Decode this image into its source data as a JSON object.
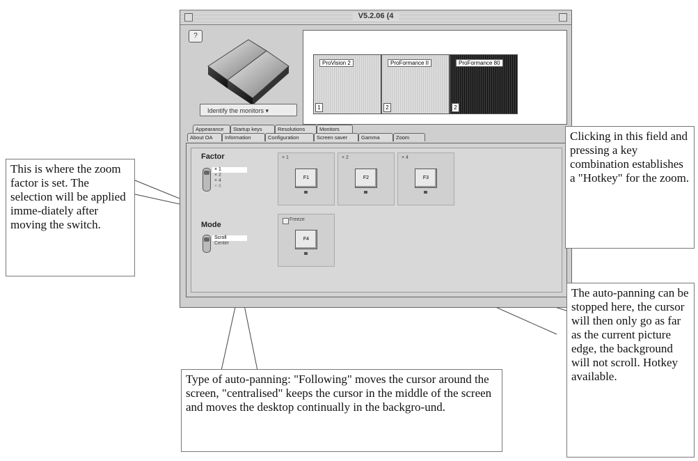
{
  "window": {
    "title": "V5.2.06 (4",
    "identify_button": "Identify the monitors",
    "monitors": [
      {
        "label": "ProVision 2",
        "number": "1"
      },
      {
        "label": "ProFormance II",
        "number": "2"
      },
      {
        "label": "ProFormance 80",
        "number": "2"
      }
    ],
    "tabs_row1": [
      "Appearance",
      "Startup keys",
      "Resolutions",
      "Monitors"
    ],
    "tabs_row2": [
      "About OA",
      "Information",
      "Configuration",
      "Screen saver",
      "Gamma",
      "Zoom"
    ],
    "zoom": {
      "factor_title": "Factor",
      "factor_options": [
        "× 1",
        "× 2",
        "× 4",
        "× 8"
      ],
      "factor_selected": "× 1",
      "mode_title": "Mode",
      "mode_options": [
        "Scroll",
        "Center"
      ],
      "hotkeys": [
        {
          "label": "× 1",
          "key": "F1"
        },
        {
          "label": "× 2",
          "key": "F2"
        },
        {
          "label": "× 4",
          "key": "F3"
        }
      ],
      "freeze_label": "Freeze",
      "freeze_key": "F4"
    }
  },
  "callouts": {
    "factor": "This is where the zoom factor is set. The selection will be applied imme-diately after moving the switch.",
    "hotkey": "Clicking in this field and pressing a key combination establishes a \"Hotkey\" for the zoom.",
    "mode": "Type of auto-panning: \"Following\" moves the cursor around the screen, \"centralised\" keeps the cursor in the middle of the screen and moves the desktop continually in the backgro-und.",
    "freeze": "The auto-panning can be stopped here, the cursor will then only go as far as the current picture edge, the background will not scroll. Hotkey available."
  }
}
